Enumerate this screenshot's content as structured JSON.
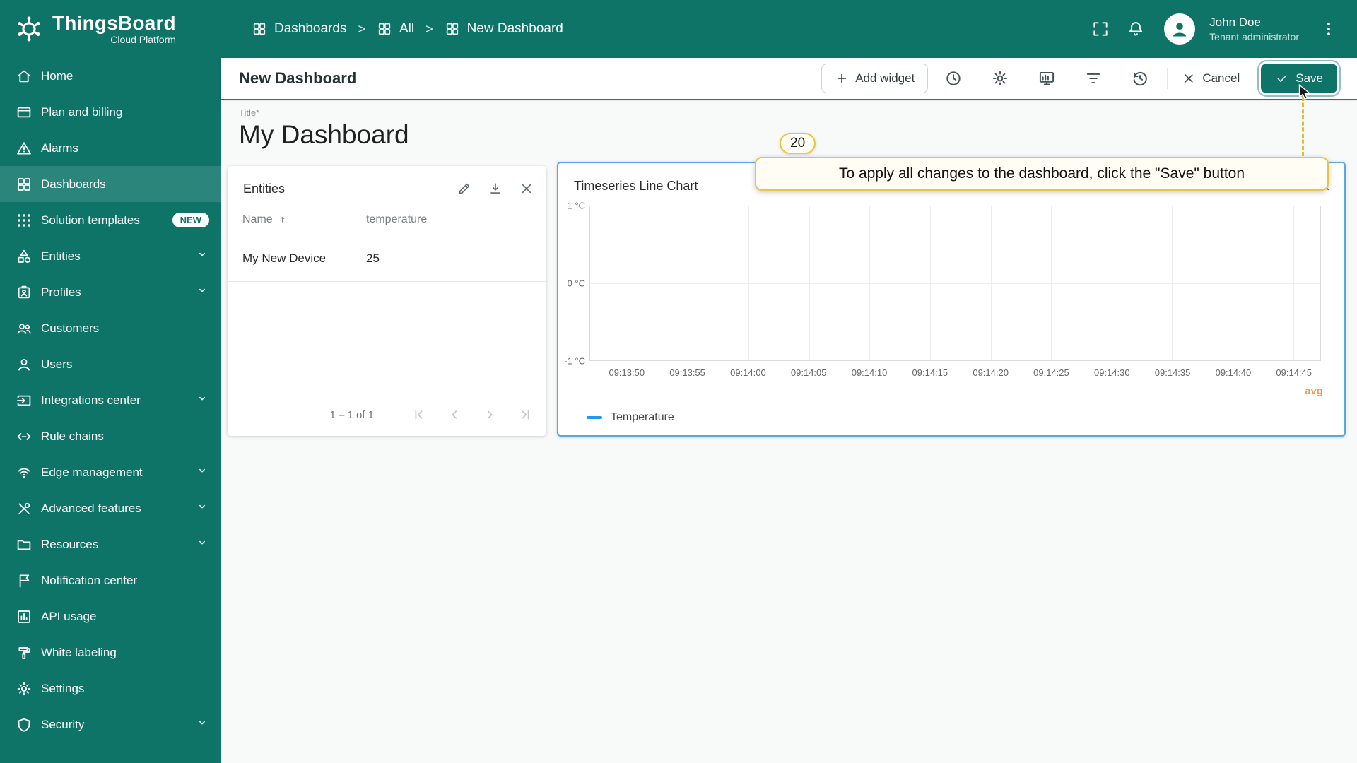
{
  "app": {
    "name": "ThingsBoard",
    "subtitle": "Cloud Platform"
  },
  "header": {
    "breadcrumbs": [
      {
        "label": "Dashboards"
      },
      {
        "label": "All"
      },
      {
        "label": "New Dashboard"
      }
    ],
    "user": {
      "name": "John Doe",
      "role": "Tenant administrator"
    }
  },
  "toolbar": {
    "title": "New Dashboard",
    "add_widget_label": "Add widget",
    "cancel_label": "Cancel",
    "save_label": "Save"
  },
  "sidebar": {
    "items": [
      {
        "label": "Home",
        "icon": "home-icon"
      },
      {
        "label": "Plan and billing",
        "icon": "billing-icon"
      },
      {
        "label": "Alarms",
        "icon": "alarms-icon"
      },
      {
        "label": "Dashboards",
        "icon": "dashboards-icon",
        "active": true
      },
      {
        "label": "Solution templates",
        "icon": "solution-templates-icon",
        "badge": "NEW"
      },
      {
        "label": "Entities",
        "icon": "entities-icon",
        "expandable": true
      },
      {
        "label": "Profiles",
        "icon": "profiles-icon",
        "expandable": true
      },
      {
        "label": "Customers",
        "icon": "customers-icon"
      },
      {
        "label": "Users",
        "icon": "users-icon"
      },
      {
        "label": "Integrations center",
        "icon": "integrations-icon",
        "expandable": true
      },
      {
        "label": "Rule chains",
        "icon": "rule-chains-icon"
      },
      {
        "label": "Edge management",
        "icon": "edge-icon",
        "expandable": true
      },
      {
        "label": "Advanced features",
        "icon": "advanced-icon",
        "expandable": true
      },
      {
        "label": "Resources",
        "icon": "resources-icon",
        "expandable": true
      },
      {
        "label": "Notification center",
        "icon": "notification-icon"
      },
      {
        "label": "API usage",
        "icon": "api-usage-icon"
      },
      {
        "label": "White labeling",
        "icon": "white-labeling-icon"
      },
      {
        "label": "Settings",
        "icon": "settings-icon"
      },
      {
        "label": "Security",
        "icon": "security-icon",
        "expandable": true
      }
    ]
  },
  "dashboard": {
    "title_label": "Title*",
    "title_value": "My Dashboard"
  },
  "entities_widget": {
    "title": "Entities",
    "columns": [
      "Name",
      "temperature"
    ],
    "rows": [
      {
        "name": "My New Device",
        "temperature": "25"
      }
    ],
    "pagination": "1 – 1 of 1"
  },
  "chart_widget": {
    "title": "Timeseries Line Chart",
    "legend_label": "Temperature",
    "agg_label": "avg"
  },
  "chart_data": {
    "type": "line",
    "title": "Timeseries Line Chart",
    "x": [
      "09:13:50",
      "09:13:55",
      "09:14:00",
      "09:14:05",
      "09:14:10",
      "09:14:15",
      "09:14:20",
      "09:14:25",
      "09:14:30",
      "09:14:35",
      "09:14:40",
      "09:14:45"
    ],
    "y_ticks": [
      "1 °C",
      "0 °C",
      "-1 °C"
    ],
    "ylim": [
      -1,
      1
    ],
    "series": [
      {
        "name": "Temperature",
        "values": []
      }
    ],
    "legend_position": "bottom-left",
    "grid": true
  },
  "tutorial": {
    "step": "20",
    "text": "To apply all changes to the dashboard, click the \"Save\" button"
  },
  "colors": {
    "primary_teal": "#0e7467",
    "active_item_teal": "#2c857a",
    "selected_widget_border": "#56a9e4",
    "tutorial_yellow": "#eec43d",
    "legend_line_blue": "#2196f3",
    "aggregation_orange": "#f2994a"
  }
}
